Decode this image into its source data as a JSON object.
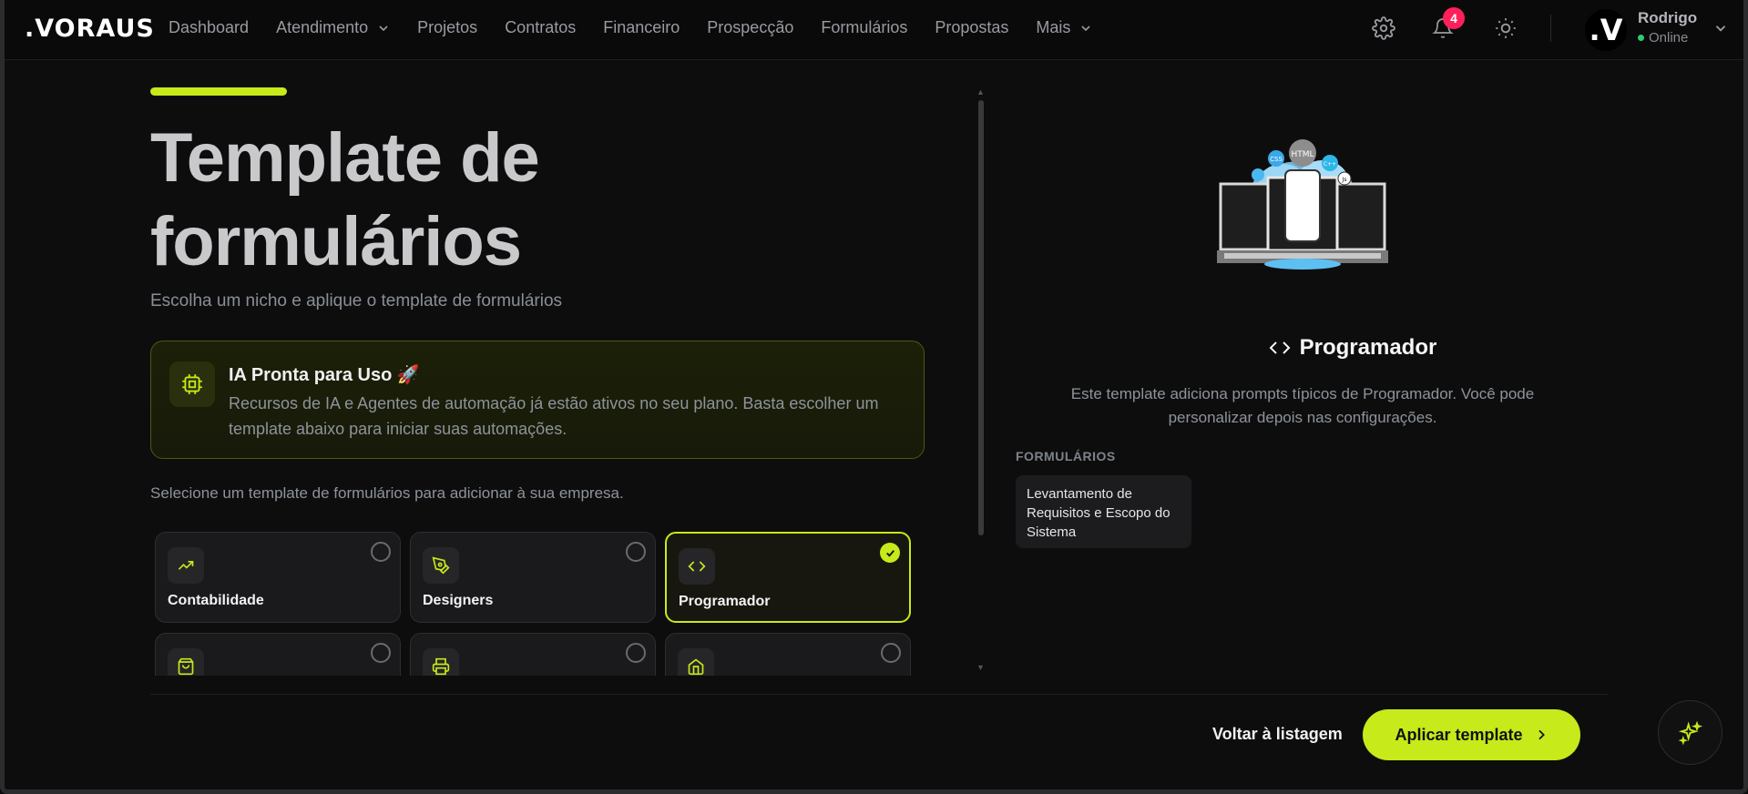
{
  "app": {
    "logo": ".VORAUS"
  },
  "nav": {
    "items": [
      {
        "label": "Dashboard",
        "has_dropdown": false
      },
      {
        "label": "Atendimento",
        "has_dropdown": true
      },
      {
        "label": "Projetos",
        "has_dropdown": false
      },
      {
        "label": "Contratos",
        "has_dropdown": false
      },
      {
        "label": "Financeiro",
        "has_dropdown": false
      },
      {
        "label": "Prospecção",
        "has_dropdown": false
      },
      {
        "label": "Formulários",
        "has_dropdown": false
      },
      {
        "label": "Propostas",
        "has_dropdown": false
      },
      {
        "label": "Mais",
        "has_dropdown": true
      }
    ],
    "icons": [
      "gear-icon",
      "bell-icon",
      "sun-icon"
    ],
    "notification_count": "4",
    "user": {
      "avatar_letter": ".V",
      "name": "Rodrigo",
      "status": "Online"
    }
  },
  "page": {
    "title": "Template de formulários",
    "subtitle": "Escolha um nicho e aplique o template de formulários",
    "ia_card": {
      "icon": "chip-icon",
      "title": "IA Pronta para Uso 🚀",
      "description": "Recursos de IA e Agentes de automação já estão ativos no seu plano. Basta escolher um template abaixo para iniciar suas automações."
    },
    "select_hint": "Selecione um template de formulários para adicionar à sua empresa.",
    "templates": [
      {
        "label": "Contabilidade",
        "icon": "trending-up-icon",
        "selected": false
      },
      {
        "label": "Designers",
        "icon": "pen-tool-icon",
        "selected": false
      },
      {
        "label": "Programador",
        "icon": "code-icon",
        "selected": true
      },
      {
        "label": "",
        "icon": "shopping-bag-icon",
        "selected": false
      },
      {
        "label": "",
        "icon": "printer-icon",
        "selected": false
      },
      {
        "label": "",
        "icon": "home-icon",
        "selected": false
      }
    ]
  },
  "detail": {
    "title": "Programador",
    "description": "Este template adiciona prompts típicos de Programador. Você pode personalizar depois nas configurações.",
    "forms_label": "FORMULÁRIOS",
    "forms": [
      "Levantamento de Requisitos e Escopo do Sistema"
    ],
    "illustration_tags": [
      "HTML",
      "CSS",
      "JS",
      "C++"
    ]
  },
  "footer": {
    "back_label": "Voltar à listagem",
    "apply_label": "Aplicar template"
  },
  "colors": {
    "accent": "#c6ea1a",
    "background": "#0d0d0e",
    "badge": "#ff1f5a"
  }
}
